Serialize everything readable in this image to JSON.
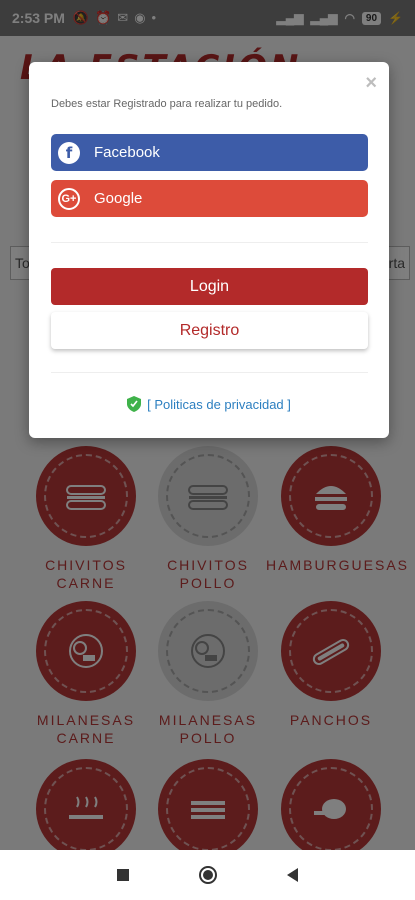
{
  "status_bar": {
    "time": "2:53 PM",
    "battery": "90"
  },
  "app": {
    "brand": "LA ESTACIÓN",
    "search": {
      "left": "To",
      "right": "rta"
    },
    "categories": [
      {
        "title": "CHIVITOS",
        "subtitle": "CARNE"
      },
      {
        "title": "CHIVITOS",
        "subtitle": "POLLO"
      },
      {
        "title": "HAMBURGUESAS",
        "subtitle": ""
      },
      {
        "title": "MILANESAS",
        "subtitle": "CARNE"
      },
      {
        "title": "MILANESAS",
        "subtitle": "POLLO"
      },
      {
        "title": "PANCHOS",
        "subtitle": ""
      }
    ],
    "colors": {
      "brand": "#b32a2a",
      "facebook": "#3d5ca8",
      "google": "#dd4b3a",
      "privacy": "#2c7fc0",
      "shield": "#3fb24a"
    }
  },
  "modal": {
    "close": "×",
    "prompt": "Debes estar Registrado para realizar tu pedido.",
    "facebook_label": "Facebook",
    "google_label": "Google",
    "google_icon": "G+",
    "login_label": "Login",
    "register_label": "Registro",
    "privacy_label": "[ Politicas de privacidad ]"
  }
}
